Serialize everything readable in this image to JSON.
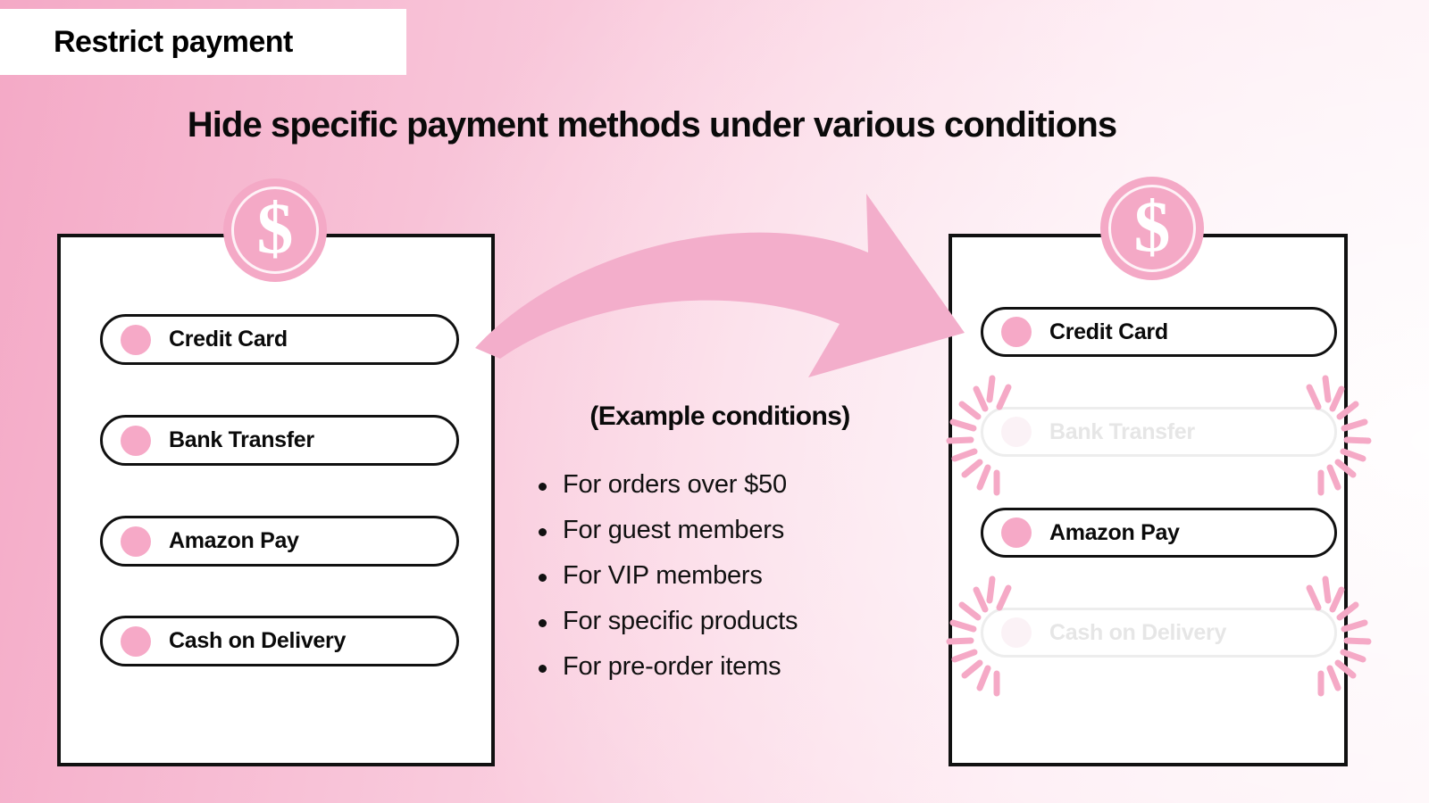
{
  "banner": {
    "title": "Restrict payment"
  },
  "headline": {
    "text": "Hide specific payment methods under various conditions"
  },
  "coin": {
    "symbol": "$",
    "icon": "dollar-coin-icon",
    "color": "#f4a9c6"
  },
  "arrow": {
    "icon": "curved-right-arrow-icon",
    "color": "#f3aecb"
  },
  "colors": {
    "accent_pink": "#f4a9c6",
    "pill_dot": "#f6a9c7",
    "sparkle": "#f5a9c6",
    "disabled_text": "#e6e6e6",
    "disabled_border": "#ededed",
    "border_black": "#111111",
    "bg_left": "#f4a9c6",
    "bg_right": "#fdf1f6"
  },
  "left_card": {
    "name": "all-payment-methods",
    "methods": [
      {
        "label": "Credit Card",
        "state": "visible"
      },
      {
        "label": "Bank Transfer",
        "state": "visible"
      },
      {
        "label": "Amazon Pay",
        "state": "visible"
      },
      {
        "label": "Cash on Delivery",
        "state": "visible"
      }
    ]
  },
  "right_card": {
    "name": "filtered-payment-methods",
    "methods": [
      {
        "label": "Credit Card",
        "state": "visible"
      },
      {
        "label": "Bank Transfer",
        "state": "hidden"
      },
      {
        "label": "Amazon Pay",
        "state": "visible"
      },
      {
        "label": "Cash on Delivery",
        "state": "hidden"
      }
    ]
  },
  "conditions": {
    "title": "(Example conditions)",
    "items": [
      "For orders over $50",
      "For guest members",
      "For VIP members",
      "For specific products",
      "For pre-order items"
    ]
  }
}
